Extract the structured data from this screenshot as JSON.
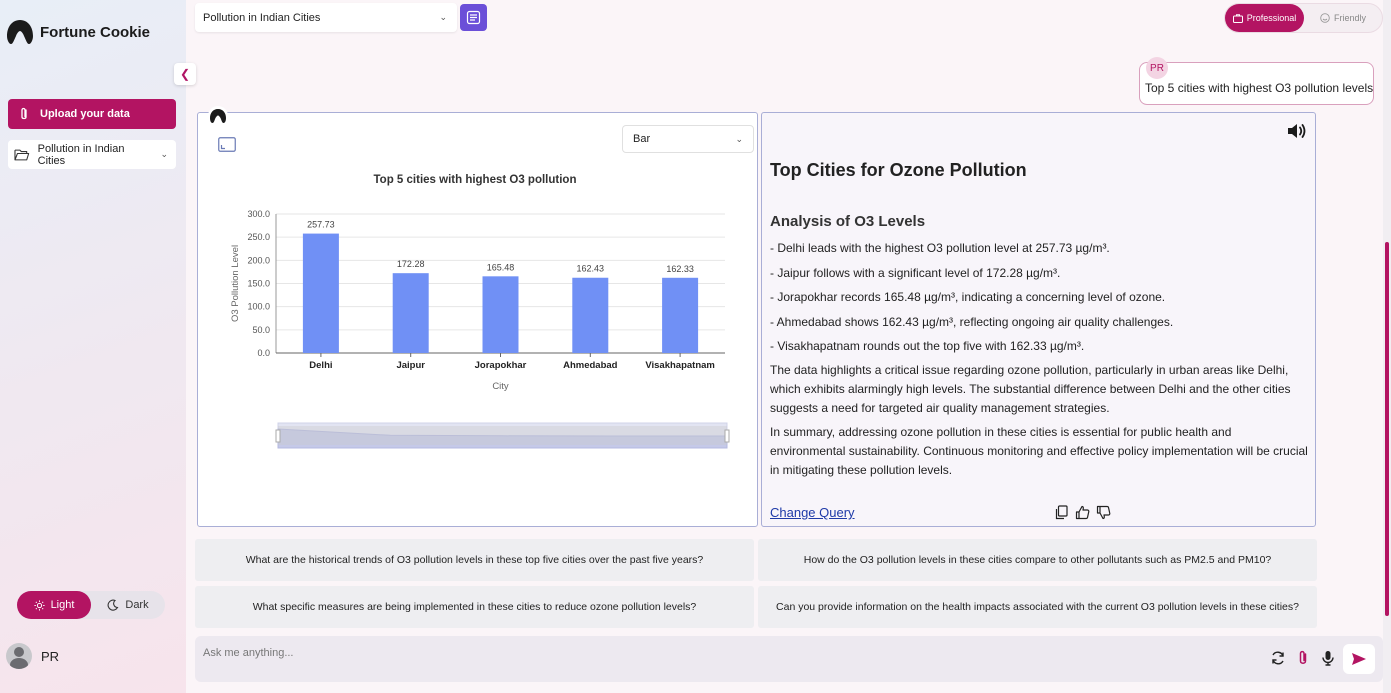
{
  "app": {
    "name": "Fortune Cookie"
  },
  "sidebar": {
    "upload_label": "Upload your data",
    "dataset_label": "Pollution in Indian Cities",
    "theme": {
      "light_label": "Light",
      "dark_label": "Dark",
      "active": "light"
    },
    "user_name": "PR"
  },
  "topbar": {
    "dataset_select_value": "Pollution in Indian Cities",
    "mode": {
      "professional_label": "Professional",
      "friendly_label": "Friendly",
      "active": "professional"
    }
  },
  "query": {
    "badge": "PR",
    "text": "Top 5 cities with highest O3 pollution levels"
  },
  "chart_panel": {
    "chart_type_value": "Bar"
  },
  "chart_data": {
    "type": "bar",
    "title": "Top 5 cities with highest O3 pollution",
    "xlabel": "City",
    "ylabel": "O3 Pollution Level",
    "categories": [
      "Delhi",
      "Jaipur",
      "Jorapokhar",
      "Ahmedabad",
      "Visakhapatnam"
    ],
    "values": [
      257.73,
      172.28,
      165.48,
      162.43,
      162.33
    ],
    "value_labels": [
      "257.73",
      "172.28",
      "165.48",
      "162.43",
      "162.33"
    ],
    "ylim": [
      0,
      300
    ],
    "yticks": [
      "0.0",
      "50.0",
      "100.0",
      "150.0",
      "200.0",
      "250.0",
      "300.0"
    ],
    "grid": true,
    "bar_color": "#7090f5",
    "zoom_slider": true
  },
  "response": {
    "title": "Top Cities for Ozone Pollution",
    "subtitle": "Analysis of O3 Levels",
    "bullets": [
      "- Delhi leads with the highest O3 pollution level at 257.73 µg/m³.",
      "- Jaipur follows with a significant level of 172.28 µg/m³.",
      "- Jorapokhar records 165.48 µg/m³, indicating a concerning level of ozone.",
      "- Ahmedabad shows 162.43 µg/m³, reflecting ongoing air quality challenges.",
      "- Visakhapatnam rounds out the top five with 162.33 µg/m³."
    ],
    "paragraph1": "The data highlights a critical issue regarding ozone pollution, particularly in urban areas like Delhi, which exhibits alarmingly high levels. The substantial difference between Delhi and the other cities suggests a need for targeted air quality management strategies.",
    "paragraph2": "In summary, addressing ozone pollution in these cities is essential for public health and environmental sustainability. Continuous monitoring and effective policy implementation will be crucial in mitigating these pollution levels.",
    "change_query_label": "Change Query"
  },
  "suggestions": [
    "What are the historical trends of O3 pollution levels in these top five cities over the past five years?",
    "How do the O3 pollution levels in these cities compare to other pollutants such as PM2.5 and PM10?",
    "What specific measures are being implemented in these cities to reduce ozone pollution levels?",
    "Can you provide information on the health impacts associated with the current O3 pollution levels in these cities?"
  ],
  "input": {
    "placeholder": "Ask me anything..."
  },
  "colors": {
    "accent": "#b31462",
    "purple": "#6b4fd8",
    "bar": "#7090f5",
    "link": "#1e3aa8"
  }
}
